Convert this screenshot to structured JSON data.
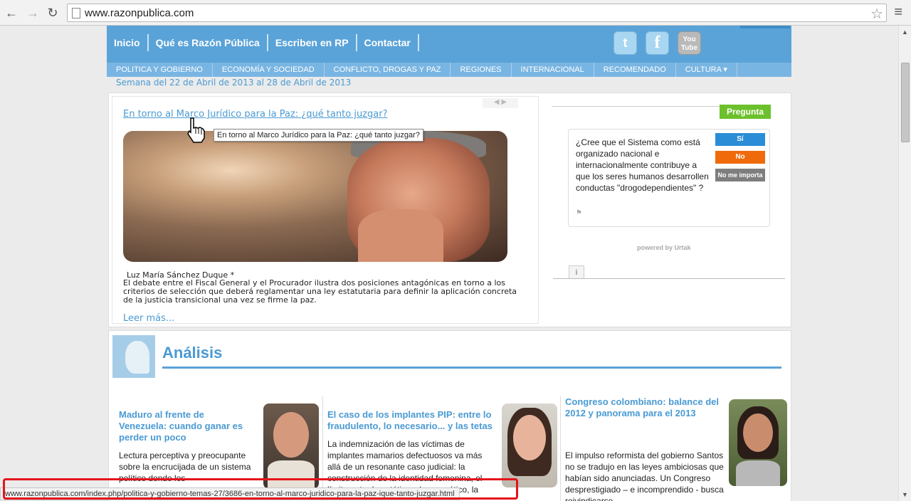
{
  "browser": {
    "url": "www.razonpublica.com",
    "status_url": "www.razonpublica.com/index.php/politica-y-gobierno-temas-27/3686-en-torno-al-marco-juridico-para-la-paz-ique-tanto-juzgar.html"
  },
  "header": {
    "topnav": [
      "Inicio",
      "Qué es Razón Pública",
      "Escriben en RP",
      "Contactar"
    ],
    "social": [
      {
        "name": "twitter-icon",
        "label": "t"
      },
      {
        "name": "facebook-icon",
        "label": "f"
      },
      {
        "name": "youtube-icon",
        "label": "You Tube"
      }
    ],
    "subnav": [
      "POLITICA Y GOBIERNO",
      "ECONOMÍA Y SOCIEDAD",
      "CONFLICTO, DROGAS Y PAZ",
      "REGIONES",
      "INTERNACIONAL",
      "RECOMENDADO",
      "CULTURA ▾"
    ],
    "week": "Semana del 22 de Abril de 2013 al 28 de Abril de 2013"
  },
  "feature": {
    "title": "En torno al Marco Jurídico para la Paz: ¿qué tanto juzgar?",
    "tooltip": "En torno al Marco Jurídico para la Paz: ¿qué tanto juzgar?",
    "slider_arrows": "◀ ▶",
    "author": "Luz María Sánchez Duque *",
    "summary": "El debate entre el Fiscal General y el Procurador ilustra dos posiciones antagónicas en torno a los criterios de selección que deberá reglamentar una ley estatutaria para definir la aplicación concreta de la justicia transicional una vez se firme la paz.",
    "read_more": "Leer más..."
  },
  "poll": {
    "ask_button": "Pregunta",
    "question": "¿Cree que el Sistema como está organizado nacional e internacionalmente contribuye a que los seres humanos desarrollen conductas \"drogodependientes\" ?",
    "options": {
      "si": "Sí",
      "no": "No",
      "nm": "No me importa"
    },
    "flag": "⚑",
    "powered": "powered by Urtak",
    "info": "i"
  },
  "analisis": {
    "title": "Análisis",
    "articles": [
      {
        "title": "Maduro al frente de Venezuela: cuando ganar es perder un poco",
        "body": "Lectura perceptiva y preocupante sobre la encrucijada de un sistema político donde los"
      },
      {
        "title": "El caso de los implantes PIP: entre lo fraudulento, lo necesario... y las tetas",
        "body": "La indemnización de las víctimas de implantes mamarios defectuosos va más allá de un resonante caso judicial: la construcción de la identidad femenina, el límite entre lo estético y lo cosmético, la"
      },
      {
        "title": "Congreso colombiano: balance del 2012 y panorama para el 2013",
        "body": "El impulso reformista del gobierno Santos no se tradujo en las leyes ambiciosas que habían sido anunciadas. Un Congreso desprestigiado – e incomprendido - busca reivindicarse"
      }
    ]
  },
  "colors": {
    "brand_blue": "#5aa3d8",
    "link_blue": "#4a9ad3",
    "green": "#6cc02b",
    "orange": "#f06a0c",
    "highlight_red": "#e4141b"
  }
}
